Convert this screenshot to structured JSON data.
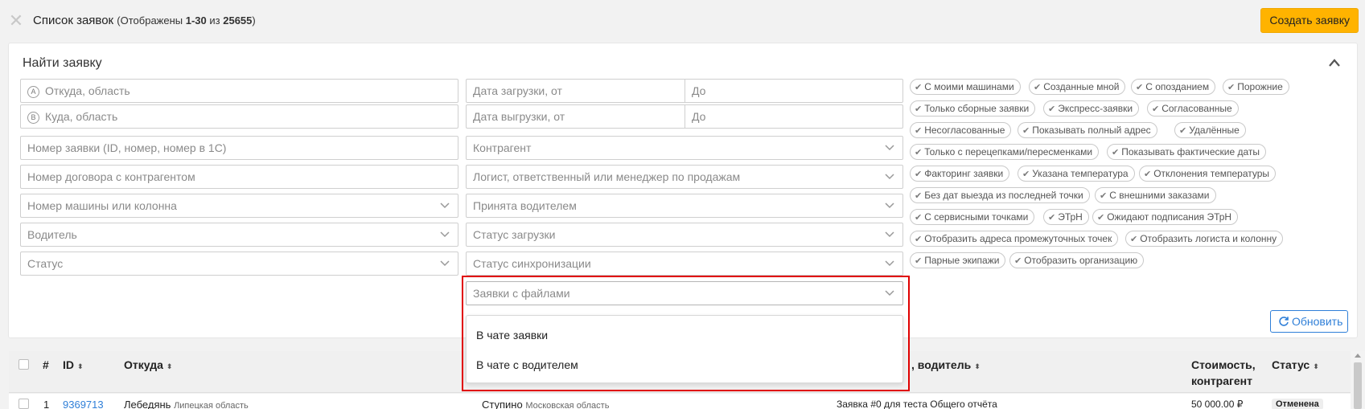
{
  "header": {
    "title": "Список заявок",
    "counter_prefix": "(Отображены ",
    "range": "1-30",
    "counter_mid": " из ",
    "total": "25655",
    "counter_suffix": ")",
    "create_button": "Создать заявку"
  },
  "filters": {
    "title": "Найти заявку",
    "from_marker": "A",
    "to_marker": "B",
    "from_placeholder": "Откуда, область",
    "to_placeholder": "Куда, область",
    "load_date_from": "Дата загрузки, от",
    "load_date_to": "До",
    "unload_date_from": "Дата выгрузки, от",
    "unload_date_to": "До",
    "order_number": "Номер заявки (ID, номер, номер в 1С)",
    "contract_number": "Номер договора с контрагентом",
    "vehicle": "Номер машины или колонна",
    "driver": "Водитель",
    "status": "Статус",
    "counterparty": "Контрагент",
    "logist": "Логист, ответственный или менеджер по продажам",
    "accepted_by_driver": "Принята водителем",
    "loading_status": "Статус загрузки",
    "sync_status": "Статус синхронизации",
    "with_files": "Заявки с файлами",
    "refresh_button": "Обновить"
  },
  "files_dropdown": {
    "options": [
      "В чате заявки",
      "В чате с водителем"
    ]
  },
  "tags": [
    "С моими машинами",
    "Созданные мной",
    "С опозданием",
    "Порожние",
    "Только сборные заявки",
    "Экспресс-заявки",
    "Согласованные",
    "Несогласованные",
    "Показывать полный адрес",
    "Удалённые",
    "Только с перецепками/пересменками",
    "Показывать фактические даты",
    "Факторинг заявки",
    "Указана температура",
    "Отклонения температуры",
    "Без дат выезда из последней точки",
    "С внешними заказами",
    "С сервисными точками",
    "ЭТрН",
    "Ожидают подписания ЭТрН",
    "Отобразить адреса промежуточных точек",
    "Отобразить логиста и колонну",
    "Парные экипажи",
    "Отобразить организацию"
  ],
  "table": {
    "headers": {
      "num": "#",
      "id": "ID",
      "from": "Откуда",
      "vehicle_driver": ", водитель",
      "cost_line1": "Стоимость,",
      "cost_line2": "контрагент",
      "status": "Статус"
    },
    "rows": [
      {
        "num": "1",
        "id": "9369713",
        "from_city": "Лебедянь",
        "from_region": "Липецкая область",
        "to_city": "Ступино",
        "to_region": "Московская область",
        "driver_info": "Заявка #0 для теста Общего отчёта",
        "cost": "50 000.00 ₽",
        "status": "Отменена"
      }
    ]
  },
  "colors": {
    "accent_yellow": "#ffb300",
    "link_blue": "#2f7fd8",
    "highlight_red": "#e00000"
  }
}
